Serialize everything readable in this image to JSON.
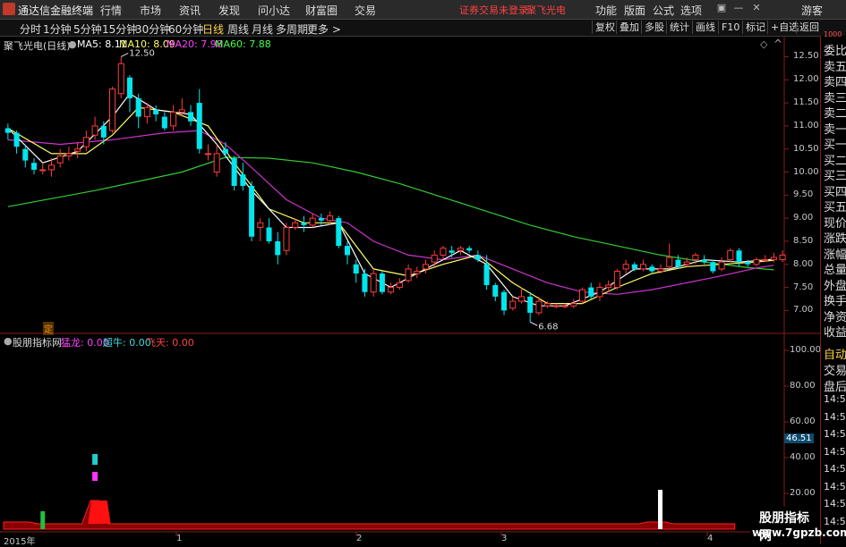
{
  "menubar": {
    "app_name": "通达信金融终端",
    "menu": [
      "行情",
      "市场",
      "资讯",
      "发现",
      "问小达",
      "财富圈",
      "交易"
    ],
    "notice": "证券交易未登录",
    "stock_name": "聚飞光电",
    "right_menu": [
      "功能",
      "版面",
      "公式",
      "选项"
    ],
    "user": "游客"
  },
  "periodbar": {
    "periods": [
      "分时",
      "1分钟",
      "5分钟",
      "15分钟",
      "30分钟",
      "60分钟",
      "日线",
      "周线",
      "月线",
      "多周期",
      "更多 >"
    ],
    "active": "日线",
    "tools": [
      "复权",
      "叠加",
      "多股",
      "统计",
      "画线",
      "F10",
      "标记",
      "+自选",
      "返回"
    ]
  },
  "main_chart": {
    "title": "聚飞光电(日线)",
    "ma": [
      {
        "label": "MA5: 8.11",
        "color": "#ffffff"
      },
      {
        "label": "MA10: 8.09",
        "color": "#ffff66"
      },
      {
        "label": "MA20: 7.98",
        "color": "#ff44ff"
      },
      {
        "label": "MA60: 7.88",
        "color": "#44ff44"
      }
    ],
    "high_label": "12.50",
    "low_label": "6.68",
    "marker": "定",
    "y_ticks": [
      "12.50",
      "12.00",
      "11.50",
      "11.00",
      "10.50",
      "10.00",
      "9.50",
      "9.00",
      "8.50",
      "8.00",
      "7.50",
      "7.00"
    ]
  },
  "sub_chart": {
    "title": "股朋指标网",
    "items": [
      {
        "label": "猛龙: 0.00",
        "color": "#ff44ff"
      },
      {
        "label": "超牛: 0.00",
        "color": "#44dddd"
      },
      {
        "label": "飞天: 0.00",
        "color": "#ff4444"
      }
    ],
    "y_ticks": [
      "100.00",
      "80.00",
      "60.00",
      "40.00",
      "20.00"
    ],
    "current_value": "46.51"
  },
  "x_axis": [
    "2015年",
    "1",
    "2",
    "3",
    "4"
  ],
  "right_panel": {
    "quote_labels": [
      "委比",
      "卖五",
      "卖四",
      "卖三",
      "卖二",
      "卖一",
      "买一",
      "买二",
      "买三",
      "买四",
      "买五",
      "现价",
      "涨跌",
      "涨幅",
      "总量",
      "外盘",
      "换手",
      "净资",
      "收益"
    ],
    "trade_labels": [
      "自动",
      "交易",
      "盘后"
    ],
    "times": [
      "14:56",
      "14:56",
      "14:56",
      "14:56",
      "14:56",
      "14:56",
      "14:56",
      "14:56"
    ],
    "top_value": "1000"
  },
  "watermark": {
    "line1": "股朋指标网",
    "line2": "www.7gpzb.com"
  },
  "chart_data": {
    "type": "candlestick",
    "title": "聚飞光电(日线)",
    "ylim": [
      6.6,
      12.8
    ],
    "candles": [
      [
        10.95,
        10.85,
        11.05,
        10.7
      ],
      [
        10.85,
        10.55,
        10.9,
        10.4
      ],
      [
        10.5,
        10.25,
        10.6,
        10.1
      ],
      [
        10.2,
        10.05,
        10.3,
        9.95
      ],
      [
        10.05,
        10.05,
        10.2,
        9.95
      ],
      [
        10.05,
        10.15,
        10.3,
        9.9
      ],
      [
        10.2,
        10.35,
        10.5,
        10.1
      ],
      [
        10.35,
        10.4,
        10.55,
        10.25
      ],
      [
        10.45,
        10.5,
        10.65,
        10.3
      ],
      [
        10.55,
        10.75,
        10.9,
        10.45
      ],
      [
        10.8,
        11.0,
        11.2,
        10.7
      ],
      [
        11.0,
        10.75,
        11.1,
        10.6
      ],
      [
        10.9,
        11.8,
        11.85,
        10.85
      ],
      [
        11.7,
        12.35,
        12.5,
        11.6
      ],
      [
        12.05,
        11.6,
        12.1,
        11.3
      ],
      [
        11.6,
        11.2,
        11.7,
        10.95
      ],
      [
        11.2,
        11.4,
        11.5,
        11.05
      ],
      [
        11.35,
        11.25,
        11.45,
        11.1
      ],
      [
        11.2,
        10.95,
        11.3,
        10.9
      ],
      [
        11.0,
        11.3,
        11.45,
        10.9
      ],
      [
        11.3,
        11.35,
        11.6,
        11.2
      ],
      [
        11.3,
        11.1,
        11.45,
        11.0
      ],
      [
        11.5,
        10.5,
        11.8,
        10.4
      ],
      [
        10.4,
        10.4,
        10.6,
        10.25
      ],
      [
        10.0,
        10.4,
        10.6,
        9.9
      ],
      [
        10.5,
        10.4,
        10.65,
        10.3
      ],
      [
        10.3,
        9.7,
        10.35,
        9.6
      ],
      [
        9.95,
        9.7,
        10.2,
        9.6
      ],
      [
        9.7,
        8.6,
        9.8,
        8.5
      ],
      [
        8.8,
        8.9,
        9.0,
        8.5
      ],
      [
        8.8,
        8.5,
        9.0,
        8.45
      ],
      [
        8.5,
        8.2,
        8.7,
        8.0
      ],
      [
        8.3,
        8.8,
        8.9,
        8.2
      ],
      [
        8.8,
        8.9,
        9.0,
        8.75
      ],
      [
        8.9,
        8.85,
        9.05,
        8.7
      ],
      [
        8.85,
        9.0,
        9.1,
        8.8
      ],
      [
        9.0,
        8.95,
        9.1,
        8.85
      ],
      [
        8.95,
        9.05,
        9.15,
        8.85
      ],
      [
        9.0,
        8.4,
        9.05,
        8.35
      ],
      [
        8.4,
        8.2,
        8.5,
        8.0
      ],
      [
        8.0,
        7.8,
        8.1,
        7.6
      ],
      [
        7.8,
        7.4,
        7.9,
        7.3
      ],
      [
        7.4,
        7.8,
        7.9,
        7.3
      ],
      [
        7.8,
        7.4,
        7.85,
        7.35
      ],
      [
        7.4,
        7.5,
        7.6,
        7.35
      ],
      [
        7.5,
        7.6,
        7.7,
        7.45
      ],
      [
        7.65,
        7.9,
        8.0,
        7.6
      ],
      [
        7.8,
        7.85,
        7.95,
        7.7
      ],
      [
        7.9,
        8.0,
        8.1,
        7.8
      ],
      [
        8.05,
        8.2,
        8.3,
        7.95
      ],
      [
        8.2,
        8.35,
        8.4,
        8.1
      ],
      [
        8.3,
        8.25,
        8.4,
        8.15
      ],
      [
        8.3,
        8.35,
        8.4,
        8.2
      ],
      [
        8.35,
        8.3,
        8.4,
        8.25
      ],
      [
        8.2,
        8.1,
        8.3,
        8.05
      ],
      [
        8.0,
        7.55,
        8.2,
        7.45
      ],
      [
        7.55,
        7.3,
        7.6,
        7.2
      ],
      [
        7.4,
        7.0,
        7.45,
        6.9
      ],
      [
        7.05,
        7.2,
        7.3,
        7.0
      ],
      [
        7.2,
        7.3,
        7.5,
        7.15
      ],
      [
        7.3,
        6.95,
        7.4,
        6.75
      ],
      [
        6.95,
        7.2,
        7.3,
        6.9
      ],
      [
        7.1,
        7.15,
        7.2,
        7.05
      ],
      [
        7.1,
        7.1,
        7.15,
        7.05
      ],
      [
        7.1,
        7.1,
        7.15,
        7.05
      ],
      [
        7.1,
        7.15,
        7.25,
        7.05
      ],
      [
        7.2,
        7.45,
        7.5,
        7.15
      ],
      [
        7.5,
        7.3,
        7.6,
        7.25
      ],
      [
        7.3,
        7.5,
        7.6,
        7.2
      ],
      [
        7.5,
        7.55,
        7.65,
        7.4
      ],
      [
        7.5,
        7.85,
        7.9,
        7.45
      ],
      [
        7.9,
        8.0,
        8.1,
        7.8
      ],
      [
        8.0,
        7.9,
        8.05,
        7.85
      ],
      [
        7.9,
        8.0,
        8.1,
        7.85
      ],
      [
        7.95,
        7.85,
        8.0,
        7.8
      ],
      [
        7.85,
        7.9,
        8.0,
        7.8
      ],
      [
        7.95,
        8.15,
        8.45,
        7.9
      ],
      [
        8.1,
        7.95,
        8.2,
        7.9
      ],
      [
        8.0,
        8.05,
        8.15,
        7.95
      ],
      [
        8.1,
        8.2,
        8.25,
        8.0
      ],
      [
        8.1,
        8.05,
        8.2,
        8.0
      ],
      [
        8.05,
        7.85,
        8.1,
        7.8
      ],
      [
        7.9,
        8.05,
        8.15,
        7.85
      ],
      [
        8.1,
        8.3,
        8.35,
        8.05
      ],
      [
        8.3,
        8.05,
        8.35,
        7.95
      ],
      [
        8.05,
        8.0,
        8.1,
        7.95
      ],
      [
        8.0,
        8.1,
        8.15,
        7.95
      ],
      [
        8.1,
        8.1,
        8.2,
        8.05
      ],
      [
        8.1,
        8.15,
        8.25,
        8.05
      ],
      [
        8.1,
        8.2,
        8.3,
        8.05
      ]
    ],
    "ma5": [
      [
        0,
        10.95
      ],
      [
        4,
        10.2
      ],
      [
        8,
        10.45
      ],
      [
        12,
        11.2
      ],
      [
        14,
        11.7
      ],
      [
        17,
        11.35
      ],
      [
        21,
        11.25
      ],
      [
        24,
        10.6
      ],
      [
        28,
        9.6
      ],
      [
        32,
        8.8
      ],
      [
        35,
        8.8
      ],
      [
        38,
        8.9
      ],
      [
        41,
        7.8
      ],
      [
        44,
        7.5
      ],
      [
        48,
        7.9
      ],
      [
        52,
        8.3
      ],
      [
        55,
        8.0
      ],
      [
        58,
        7.3
      ],
      [
        61,
        7.1
      ],
      [
        64,
        7.1
      ],
      [
        68,
        7.4
      ],
      [
        72,
        7.9
      ],
      [
        76,
        7.9
      ],
      [
        80,
        8.1
      ],
      [
        84,
        8.05
      ],
      [
        88,
        8.11
      ]
    ],
    "ma10": [
      [
        0,
        10.95
      ],
      [
        5,
        10.4
      ],
      [
        9,
        10.4
      ],
      [
        12,
        10.8
      ],
      [
        15,
        11.4
      ],
      [
        19,
        11.3
      ],
      [
        23,
        11.0
      ],
      [
        26,
        10.2
      ],
      [
        30,
        9.2
      ],
      [
        34,
        8.9
      ],
      [
        38,
        8.9
      ],
      [
        42,
        7.9
      ],
      [
        46,
        7.75
      ],
      [
        50,
        8.0
      ],
      [
        54,
        8.2
      ],
      [
        58,
        7.6
      ],
      [
        62,
        7.15
      ],
      [
        66,
        7.15
      ],
      [
        70,
        7.5
      ],
      [
        74,
        7.8
      ],
      [
        78,
        7.95
      ],
      [
        82,
        8.0
      ],
      [
        86,
        8.05
      ],
      [
        88,
        8.09
      ]
    ],
    "ma20": [
      [
        0,
        10.7
      ],
      [
        6,
        10.6
      ],
      [
        12,
        10.7
      ],
      [
        18,
        10.85
      ],
      [
        22,
        10.9
      ],
      [
        25,
        10.6
      ],
      [
        28,
        10.1
      ],
      [
        32,
        9.4
      ],
      [
        36,
        9.0
      ],
      [
        39,
        8.9
      ],
      [
        42,
        8.5
      ],
      [
        46,
        8.2
      ],
      [
        50,
        8.1
      ],
      [
        54,
        8.2
      ],
      [
        58,
        7.9
      ],
      [
        62,
        7.6
      ],
      [
        66,
        7.4
      ],
      [
        70,
        7.35
      ],
      [
        74,
        7.45
      ],
      [
        78,
        7.6
      ],
      [
        82,
        7.75
      ],
      [
        86,
        7.92
      ],
      [
        88,
        7.98
      ]
    ],
    "ma60": [
      [
        0,
        9.25
      ],
      [
        10,
        9.6
      ],
      [
        20,
        10.0
      ],
      [
        25,
        10.32
      ],
      [
        30,
        10.3
      ],
      [
        35,
        10.2
      ],
      [
        40,
        10.0
      ],
      [
        45,
        9.75
      ],
      [
        50,
        9.45
      ],
      [
        55,
        9.15
      ],
      [
        60,
        8.85
      ],
      [
        65,
        8.6
      ],
      [
        70,
        8.4
      ],
      [
        75,
        8.2
      ],
      [
        80,
        8.05
      ],
      [
        85,
        7.93
      ],
      [
        88,
        7.88
      ]
    ],
    "sub": {
      "ylim": [
        0,
        100
      ],
      "green_bars": [
        [
          4,
          10
        ]
      ],
      "red_area": [
        [
          0,
          0
        ],
        [
          0,
          4
        ],
        [
          3,
          4
        ],
        [
          4,
          3
        ],
        [
          9,
          3
        ],
        [
          10,
          16
        ],
        [
          11,
          16
        ],
        [
          12,
          3
        ],
        [
          73,
          3
        ],
        [
          74,
          4
        ],
        [
          76,
          4
        ],
        [
          77,
          3
        ],
        [
          84,
          3
        ],
        [
          84,
          0
        ]
      ],
      "magenta_bars": [
        [
          10,
          32
        ]
      ],
      "cyan_bars": [
        [
          10,
          42
        ]
      ],
      "white_bars": [
        [
          75,
          22
        ]
      ]
    }
  }
}
